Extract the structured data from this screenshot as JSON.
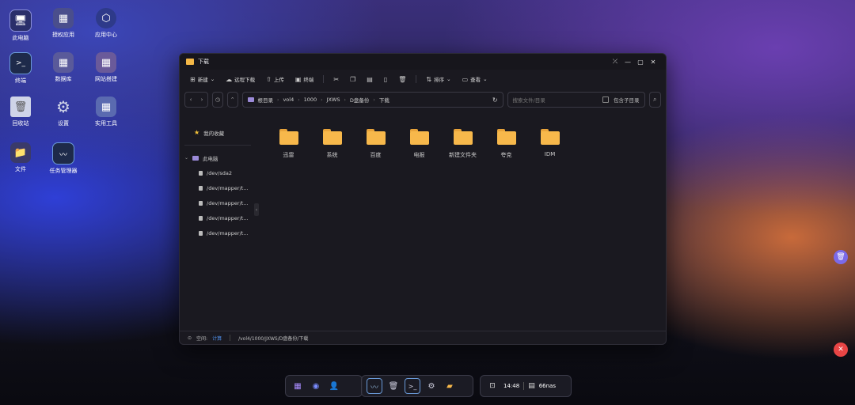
{
  "desktop": {
    "icons": [
      {
        "label": "此电脑",
        "icon": "monitor-icon"
      },
      {
        "label": "授权应用",
        "icon": "apps-icon"
      },
      {
        "label": "应用中心",
        "icon": "app-center-icon"
      },
      {
        "label": "终端",
        "icon": "terminal-icon"
      },
      {
        "label": "数据库",
        "icon": "database-icon"
      },
      {
        "label": "网站搭建",
        "icon": "website-icon"
      },
      {
        "label": "回收站",
        "icon": "trash-icon"
      },
      {
        "label": "设置",
        "icon": "gear-icon"
      },
      {
        "label": "实用工具",
        "icon": "tools-icon"
      },
      {
        "label": "文件",
        "icon": "files-icon"
      },
      {
        "label": "任务管理器",
        "icon": "task-manager-icon"
      }
    ]
  },
  "window": {
    "title": "下载",
    "toolbar": {
      "new": "新建",
      "remote_download": "远程下载",
      "upload": "上传",
      "terminal": "终端",
      "sort": "排序",
      "view": "查看"
    },
    "breadcrumb": [
      "根目录",
      "vol4",
      "1000",
      "JXWS",
      "D盘备份",
      "下载"
    ],
    "search": {
      "placeholder": "搜索文件/目录",
      "include_sub": "包含子目录"
    },
    "sidebar": {
      "favorites": "我的收藏",
      "this_pc": "此电脑",
      "devices": [
        "/dev/sda2",
        "/dev/mapper/t...",
        "/dev/mapper/t...",
        "/dev/mapper/t...",
        "/dev/mapper/t..."
      ]
    },
    "folders": [
      "迅雷",
      "系统",
      "百度",
      "电报",
      "新建文件夹",
      "夸克",
      "IDM"
    ],
    "status": {
      "space_label": "空间:",
      "space_link": "计算",
      "path": "/vol4/1000/JXWS/D盘备份/下载"
    }
  },
  "taskbar": {
    "time": "14:48",
    "host": "66nas"
  },
  "colors": {
    "folder": "#f7b84b",
    "accent_link": "#4f8fe8",
    "window_bg": "#1a1920"
  }
}
